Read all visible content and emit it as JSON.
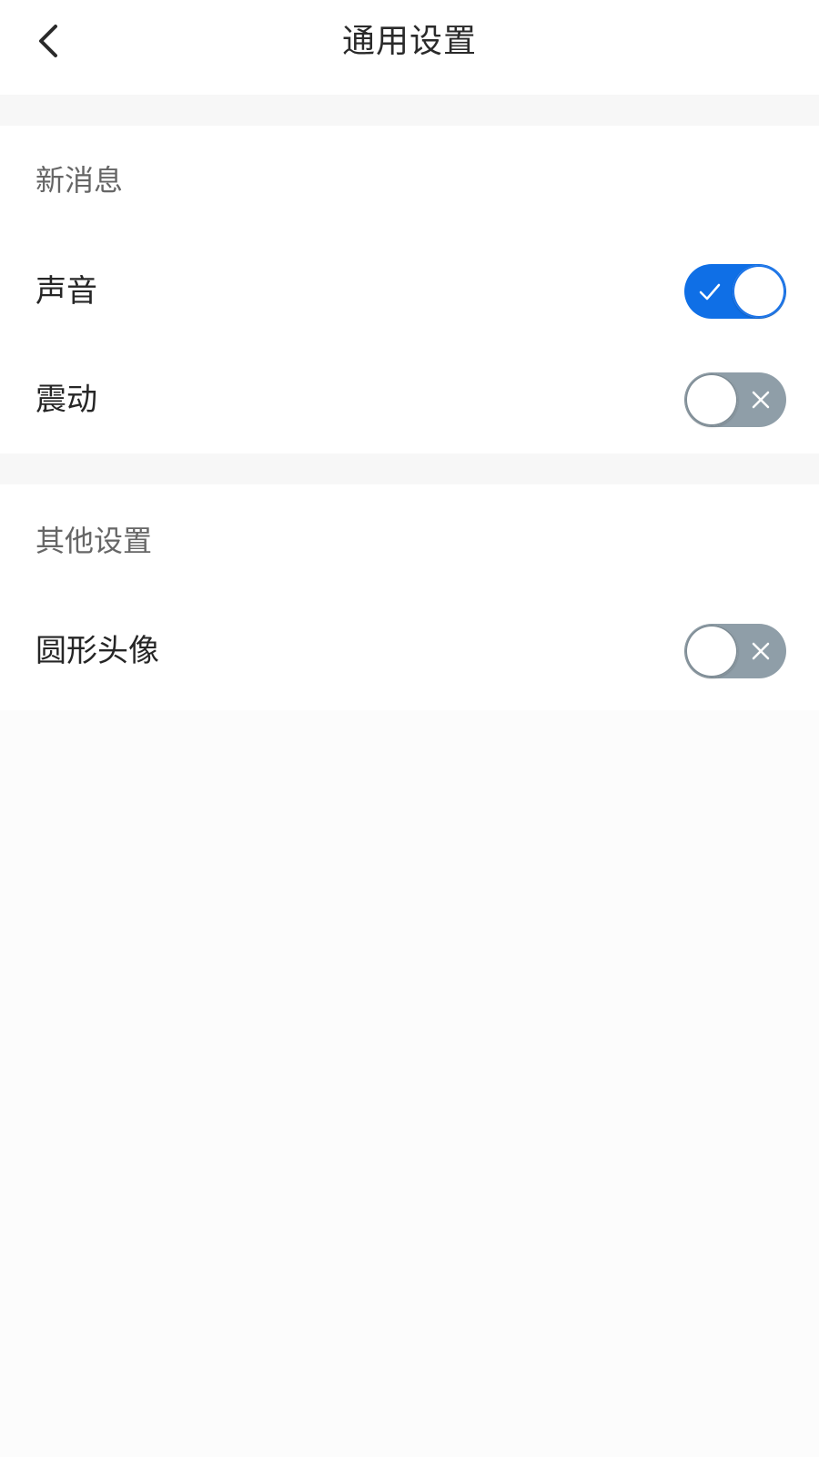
{
  "header": {
    "title": "通用设置",
    "back_icon": "chevron-left-icon"
  },
  "sections": [
    {
      "title": "新消息",
      "items": [
        {
          "label": "声音",
          "enabled": true
        },
        {
          "label": "震动",
          "enabled": false
        }
      ]
    },
    {
      "title": "其他设置",
      "items": [
        {
          "label": "圆形头像",
          "enabled": false
        }
      ]
    }
  ],
  "colors": {
    "toggle_on": "#0f6fe6",
    "toggle_off": "#8f9ea8",
    "page_bg": "#fcfcfc",
    "card_bg": "#ffffff",
    "section_title": "#666666"
  }
}
